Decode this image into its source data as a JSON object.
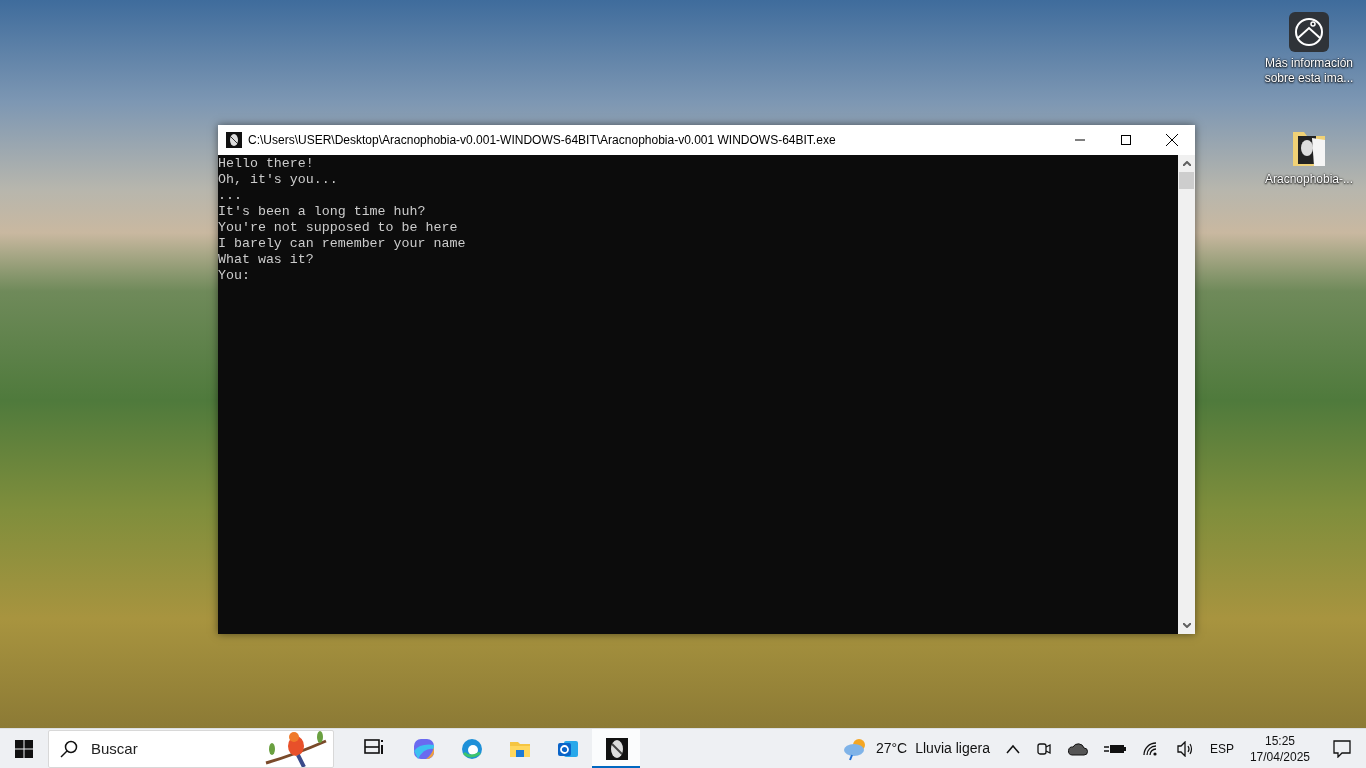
{
  "desktop_icons": [
    {
      "kind": "info",
      "label": "Más información sobre esta ima..."
    },
    {
      "kind": "folder",
      "label": "Aracnophobia-..."
    }
  ],
  "console_window": {
    "title": "C:\\Users\\USER\\Desktop\\Aracnophobia-v0.001-WINDOWS-64BIT\\Aracnophobia-v0.001 WINDOWS-64BIT.exe",
    "lines": [
      "Hello there!",
      "Oh, it's you...",
      "...",
      "It's been a long time huh?",
      "You're not supposed to be here",
      "I barely can remember your name",
      "What was it?",
      "You:"
    ]
  },
  "taskbar": {
    "search": {
      "placeholder": "Buscar"
    },
    "apps": [
      {
        "kind": "task-view",
        "selected": false
      },
      {
        "kind": "copilot",
        "selected": false
      },
      {
        "kind": "browser",
        "selected": false
      },
      {
        "kind": "folder",
        "selected": false
      },
      {
        "kind": "mail",
        "selected": false
      },
      {
        "kind": "console",
        "selected": true
      }
    ],
    "weather": {
      "temperature": "27°C",
      "condition": "Lluvia ligera"
    },
    "language": "ESP",
    "time": "15:25",
    "date": "17/04/2025"
  }
}
